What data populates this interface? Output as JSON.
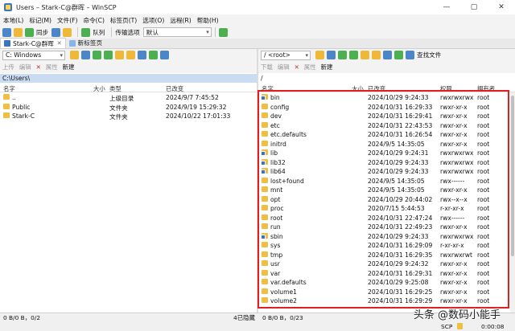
{
  "window": {
    "title": "Users – Stark-C@群晖 – WinSCP",
    "btn_min": "—",
    "btn_max": "▢",
    "btn_close": "✕"
  },
  "menu": [
    "本地(L)",
    "标记(M)",
    "文件(F)",
    "命令(C)",
    "标签页(T)",
    "选项(O)",
    "远程(R)",
    "帮助(H)"
  ],
  "toolbar": {
    "sync": "同步",
    "queue": "队列",
    "transfer_label": "传输选项",
    "transfer_value": "默认"
  },
  "tabs": {
    "session": "Stark-C@群晖",
    "new_tab": "新标签页"
  },
  "left": {
    "drive": "C: Windows",
    "actions": {
      "upload": "上传",
      "edit": "编辑",
      "properties": "属性",
      "new": "新建"
    },
    "path": "C:\\Users\\",
    "headers": {
      "name": "名字",
      "size": "大小",
      "type": "类型",
      "changed": "已改变"
    },
    "rows": [
      {
        "name": "..",
        "type": "上级目录",
        "changed": "2024/9/7 7:45:52"
      },
      {
        "name": "Public",
        "type": "文件夹",
        "changed": "2024/9/19 15:29:32"
      },
      {
        "name": "Stark-C",
        "type": "文件夹",
        "changed": "2024/10/22 17:01:33"
      }
    ]
  },
  "right": {
    "drive": "/ <root>",
    "find": "查找文件",
    "actions": {
      "download": "下载",
      "edit": "编辑",
      "properties": "属性",
      "new": "新建"
    },
    "path": "/",
    "headers": {
      "name": "名字",
      "size": "大小",
      "changed": "已改变",
      "rights": "权限",
      "owner": "拥有者"
    },
    "rows": [
      {
        "name": "bin",
        "changed": "2024/10/29 9:24:33",
        "rights": "rwxrwxrwx",
        "owner": "root",
        "link": true
      },
      {
        "name": "config",
        "changed": "2024/10/31 16:29:33",
        "rights": "rwxr-xr-x",
        "owner": "root"
      },
      {
        "name": "dev",
        "changed": "2024/10/31 16:29:41",
        "rights": "rwxr-xr-x",
        "owner": "root"
      },
      {
        "name": "etc",
        "changed": "2024/10/31 22:43:53",
        "rights": "rwxr-xr-x",
        "owner": "root"
      },
      {
        "name": "etc.defaults",
        "changed": "2024/10/31 16:26:54",
        "rights": "rwxr-xr-x",
        "owner": "root"
      },
      {
        "name": "initrd",
        "changed": "2024/9/5 14:35:05",
        "rights": "rwxr-xr-x",
        "owner": "root"
      },
      {
        "name": "lib",
        "changed": "2024/10/29 9:24:31",
        "rights": "rwxrwxrwx",
        "owner": "root",
        "link": true
      },
      {
        "name": "lib32",
        "changed": "2024/10/29 9:24:33",
        "rights": "rwxrwxrwx",
        "owner": "root",
        "link": true
      },
      {
        "name": "lib64",
        "changed": "2024/10/29 9:24:33",
        "rights": "rwxrwxrwx",
        "owner": "root",
        "link": true
      },
      {
        "name": "lost+found",
        "changed": "2024/9/5 14:35:05",
        "rights": "rwx------",
        "owner": "root"
      },
      {
        "name": "mnt",
        "changed": "2024/9/5 14:35:05",
        "rights": "rwxr-xr-x",
        "owner": "root"
      },
      {
        "name": "opt",
        "changed": "2024/10/29 20:44:02",
        "rights": "rwx--x--x",
        "owner": "root"
      },
      {
        "name": "proc",
        "changed": "2020/7/15 5:44:53",
        "rights": "r-xr-xr-x",
        "owner": "root"
      },
      {
        "name": "root",
        "changed": "2024/10/31 22:47:24",
        "rights": "rwx------",
        "owner": "root"
      },
      {
        "name": "run",
        "changed": "2024/10/31 22:49:23",
        "rights": "rwxr-xr-x",
        "owner": "root"
      },
      {
        "name": "sbin",
        "changed": "2024/10/29 9:24:33",
        "rights": "rwxrwxrwx",
        "owner": "root",
        "link": true
      },
      {
        "name": "sys",
        "changed": "2024/10/31 16:29:09",
        "rights": "r-xr-xr-x",
        "owner": "root"
      },
      {
        "name": "tmp",
        "changed": "2024/10/31 16:29:35",
        "rights": "rwxrwxrwt",
        "owner": "root"
      },
      {
        "name": "usr",
        "changed": "2024/10/29 9:24:32",
        "rights": "rwxr-xr-x",
        "owner": "root"
      },
      {
        "name": "var",
        "changed": "2024/10/31 16:29:31",
        "rights": "rwxr-xr-x",
        "owner": "root"
      },
      {
        "name": "var.defaults",
        "changed": "2024/10/29 9:25:08",
        "rights": "rwxr-xr-x",
        "owner": "root"
      },
      {
        "name": "volume1",
        "changed": "2024/10/31 16:29:25",
        "rights": "rwxr-xr-x",
        "owner": "root"
      },
      {
        "name": "volume2",
        "changed": "2024/10/31 16:29:29",
        "rights": "rwxr-xr-x",
        "owner": "root"
      }
    ]
  },
  "status": {
    "left": "0 B/0 B，0/2",
    "right_hidden": "4已隐藏",
    "right": "0 B/0 B，0/23",
    "protocol": "SCP",
    "time": "0:00:08"
  },
  "watermark": "头条 @数码小能手",
  "colors": {
    "highlight": "#e02020",
    "selected_path": "#c9dcf1",
    "folder": "#f2be42"
  }
}
